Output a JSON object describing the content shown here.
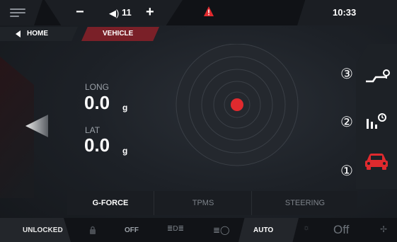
{
  "topbar": {
    "volume_minus": "−",
    "volume_value": "11",
    "volume_plus": "+",
    "clock": "10:33",
    "icons": [
      "menu-icon",
      "volume-icon",
      "warning-icon"
    ]
  },
  "nav": {
    "home_label": "HOME",
    "vehicle_label": "VEHICLE"
  },
  "readouts": {
    "long_label": "LONG",
    "long_value": "0.0",
    "long_unit": "g",
    "lat_label": "LAT",
    "lat_value": "0.0",
    "lat_unit": "g"
  },
  "right_panel": {
    "markers": [
      "③",
      "②",
      "①"
    ],
    "icons": [
      "route-icon",
      "stats-timer-icon",
      "car-icon"
    ]
  },
  "tabs": [
    "G-FORCE",
    "TPMS",
    "STEERING"
  ],
  "status": {
    "unlocked": "UNLOCKED",
    "off_label": "OFF",
    "auto_label": "AUTO",
    "fan_off": "Off"
  },
  "colors": {
    "accent_red": "#e02a2e",
    "vehicle_tab": "#7a2028"
  }
}
